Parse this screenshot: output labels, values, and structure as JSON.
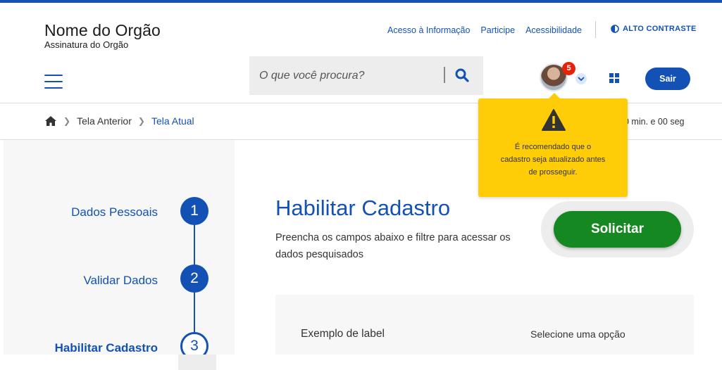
{
  "header": {
    "org_name": "Nome do Orgão",
    "org_subtitle": "Assinatura do Orgão",
    "links": [
      "Acesso à Informação",
      "Participe",
      "Acessibilidade"
    ],
    "contrast_label": "ALTO CONTRASTE",
    "search_placeholder": "O que você procura?",
    "notification_count": "5",
    "logout_label": "Sair"
  },
  "breadcrumb": {
    "previous": "Tela Anterior",
    "current": "Tela Atual"
  },
  "session_timer": "0 min. e 00 seg",
  "tooltip": {
    "message": "É recomendado que o cadastro seja atualizado antes de prosseguir."
  },
  "steps": [
    {
      "number": "1",
      "label": "Dados Pessoais"
    },
    {
      "number": "2",
      "label": "Validar Dados"
    },
    {
      "number": "3",
      "label": "Habilitar Cadastro"
    }
  ],
  "main": {
    "title": "Habilitar Cadastro",
    "description": "Preencha os campos abaixo e filtre para acessar os dados pesquisados",
    "primary_button": "Solicitar"
  },
  "form": {
    "label": "Exemplo de label",
    "select_placeholder": "Selecione uma opção"
  },
  "colors": {
    "primary": "#1351b4",
    "success": "#168821",
    "warning": "#ffcd07",
    "danger": "#e52207"
  }
}
